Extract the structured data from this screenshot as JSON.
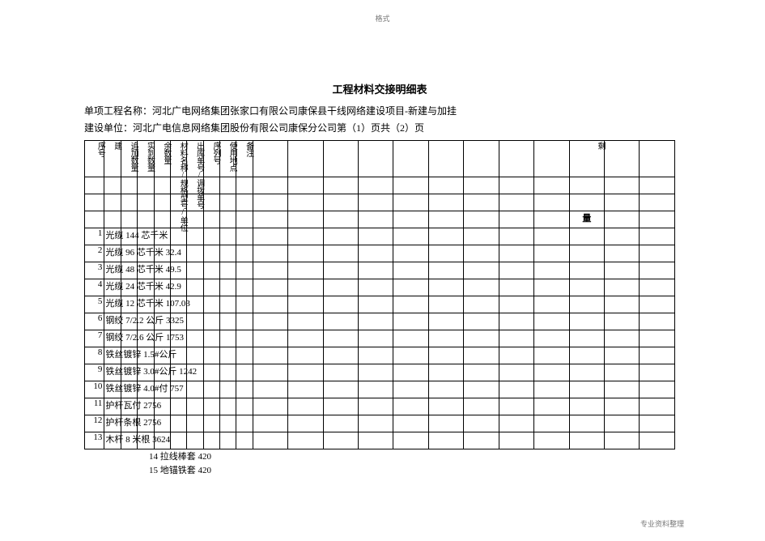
{
  "page_header_top": "格式",
  "page_footer_bottom": "专业资料整理",
  "title": "工程材料交接明细表",
  "meta_project_label": "单项工程名称：",
  "meta_project_value": "河北广电网络集团张家口有限公司康保县干线网络建设项目-新建与加挂",
  "meta_unit_label": "建设单位：",
  "meta_unit_value": "河北广电信息网络集团股份有限公司康保分公司第（1）页共（2）页",
  "head": {
    "c1": "序号",
    "c2": "建",
    "c3": "追加数量",
    "c4": "实到数量",
    "c5": "余数量",
    "c6": "材料名称/规格型号/单位",
    "c7": "出库单号/调拨单号",
    "c8": "序列号",
    "c9": "使用地点",
    "c10": "备注",
    "cS": "剩",
    "cL": "量"
  },
  "rows": [
    {
      "idx": "1",
      "txt": "光缆 144 芯千米"
    },
    {
      "idx": "2",
      "txt": "光缆 96 芯千米 32.4"
    },
    {
      "idx": "3",
      "txt": "光缆 48 芯千米 49.5"
    },
    {
      "idx": "4",
      "txt": "光缆 24 芯千米 42.9"
    },
    {
      "idx": "5",
      "txt": "光缆 12 芯千米 107.03"
    },
    {
      "idx": "6",
      "txt": "钢绞 7/2.2 公斤 3325"
    },
    {
      "idx": "7",
      "txt": "钢绞 7/2.6 公斤 1753"
    },
    {
      "idx": "8",
      "txt": "铁丝镀锌 1.5#公斤"
    },
    {
      "idx": "9",
      "txt": "铁丝镀锌 3.0#公斤 1242"
    },
    {
      "idx": "10",
      "txt": "铁丝镀锌 4.0#付 757"
    },
    {
      "idx": "11",
      "txt": "护杆瓦付 2756"
    },
    {
      "idx": "12",
      "txt": "护杆条根 2756"
    },
    {
      "idx": "13",
      "txt": "木杆 8 米根 3624"
    }
  ],
  "below_rows": [
    "14 拉线棒套 420",
    "15 地锚铁套 420"
  ],
  "chart_data": {
    "type": "table",
    "items": [
      {
        "no": 1,
        "name": "光缆",
        "spec": "144 芯",
        "unit": "千米",
        "qty": null
      },
      {
        "no": 2,
        "name": "光缆",
        "spec": "96 芯",
        "unit": "千米",
        "qty": 32.4
      },
      {
        "no": 3,
        "name": "光缆",
        "spec": "48 芯",
        "unit": "千米",
        "qty": 49.5
      },
      {
        "no": 4,
        "name": "光缆",
        "spec": "24 芯",
        "unit": "千米",
        "qty": 42.9
      },
      {
        "no": 5,
        "name": "光缆",
        "spec": "12 芯",
        "unit": "千米",
        "qty": 107.03
      },
      {
        "no": 6,
        "name": "钢绞",
        "spec": "7/2.2",
        "unit": "公斤",
        "qty": 3325
      },
      {
        "no": 7,
        "name": "钢绞",
        "spec": "7/2.6",
        "unit": "公斤",
        "qty": 1753
      },
      {
        "no": 8,
        "name": "铁丝镀锌",
        "spec": "1.5#",
        "unit": "公斤",
        "qty": null
      },
      {
        "no": 9,
        "name": "铁丝镀锌",
        "spec": "3.0#",
        "unit": "公斤",
        "qty": 1242
      },
      {
        "no": 10,
        "name": "铁丝镀锌",
        "spec": "4.0#",
        "unit": "付",
        "qty": 757
      },
      {
        "no": 11,
        "name": "护杆瓦",
        "spec": "",
        "unit": "付",
        "qty": 2756
      },
      {
        "no": 12,
        "name": "护杆条",
        "spec": "",
        "unit": "根",
        "qty": 2756
      },
      {
        "no": 13,
        "name": "木杆",
        "spec": "8 米",
        "unit": "根",
        "qty": 3624
      },
      {
        "no": 14,
        "name": "拉线棒",
        "spec": "",
        "unit": "套",
        "qty": 420
      },
      {
        "no": 15,
        "name": "地锚铁",
        "spec": "",
        "unit": "套",
        "qty": 420
      }
    ]
  }
}
